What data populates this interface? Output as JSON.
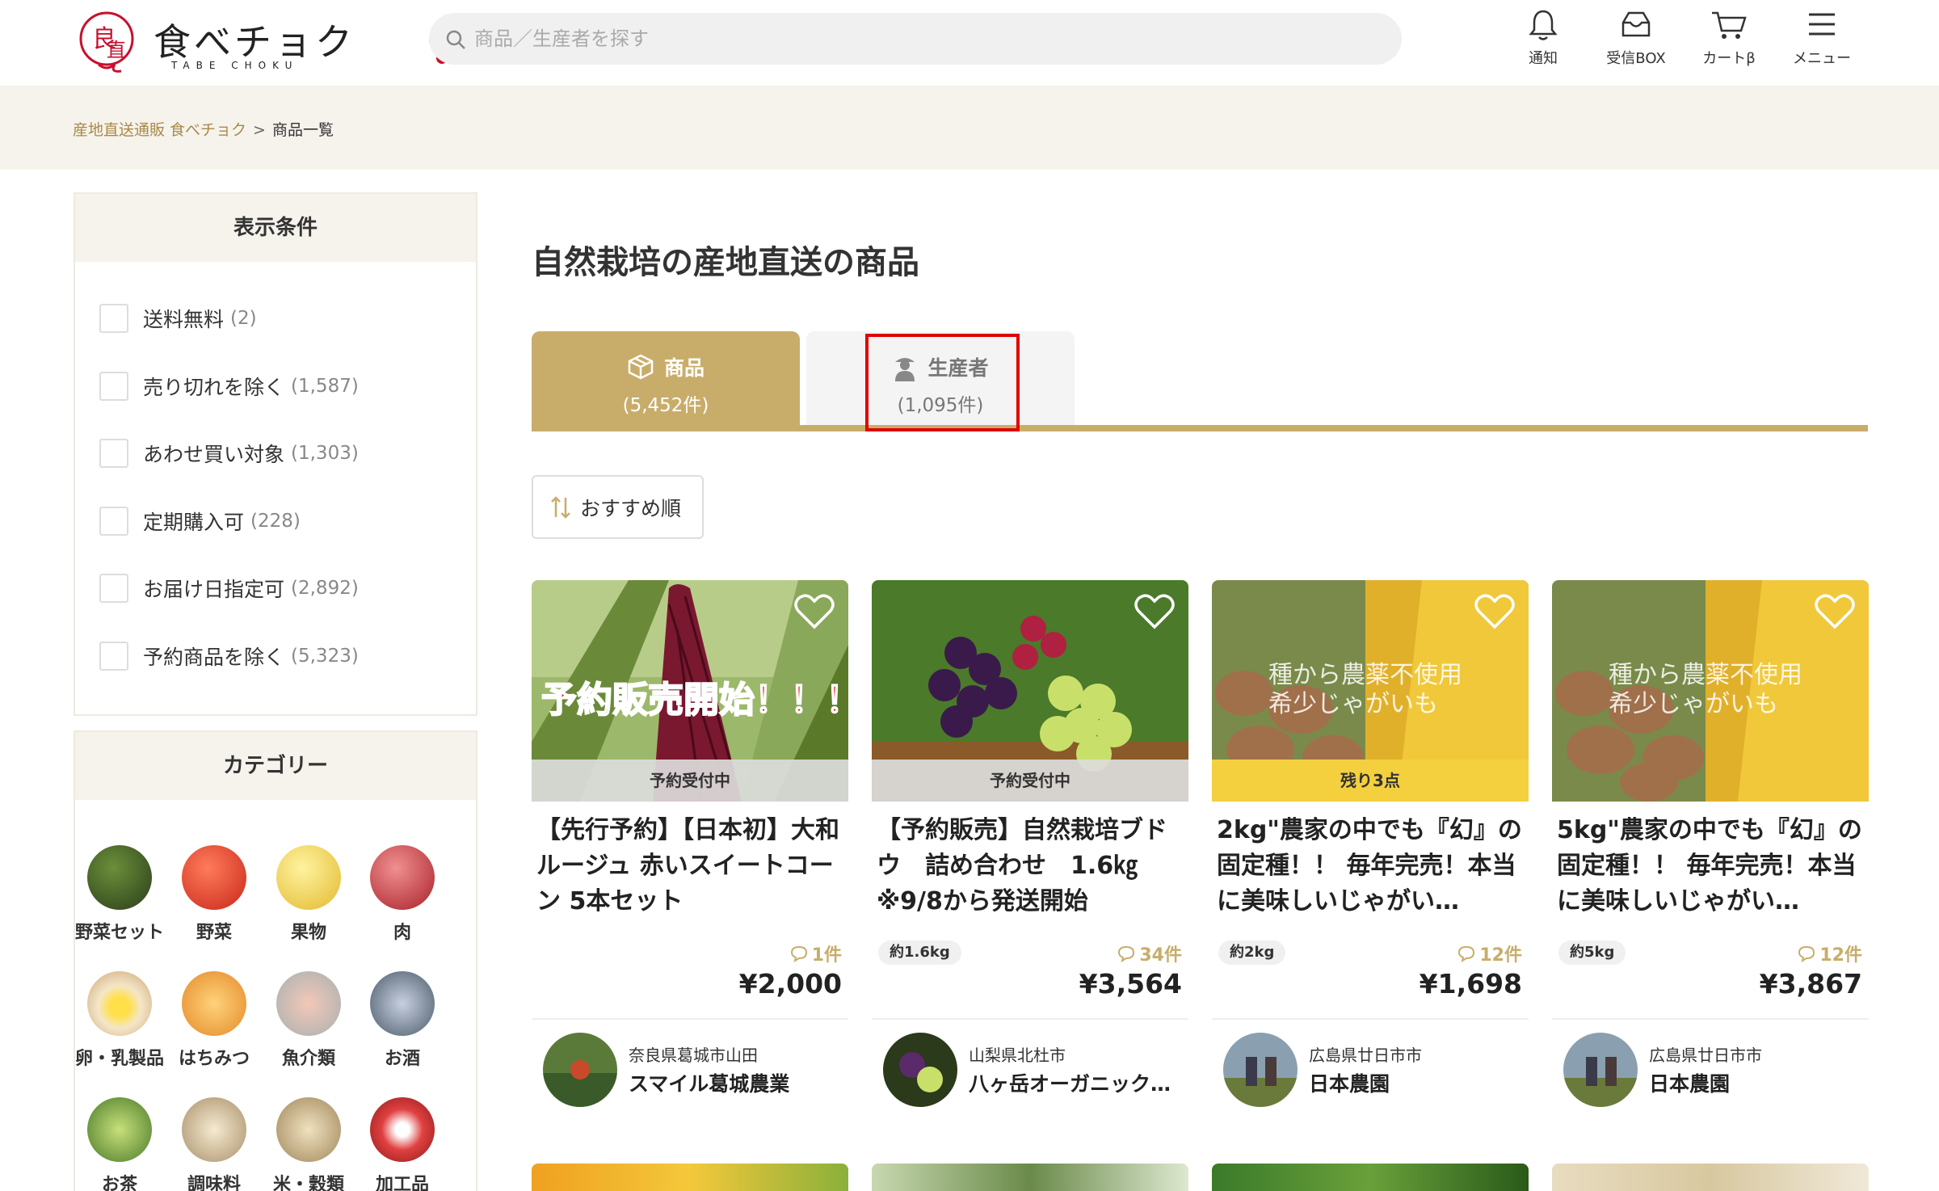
{
  "header": {
    "logo_text": "食べチョク",
    "logo_sub": "TABE CHOKU",
    "search_placeholder": "商品／生産者を探す",
    "nav": [
      {
        "label": "通知",
        "icon": "bell-icon"
      },
      {
        "label": "受信BOX",
        "icon": "inbox-icon"
      },
      {
        "label": "カートβ",
        "icon": "cart-icon"
      },
      {
        "label": "メニュー",
        "icon": "menu-icon"
      }
    ]
  },
  "breadcrumb": {
    "home": "産地直送通販 食べチョク",
    "separator": ">",
    "current": "商品一覧"
  },
  "filters": {
    "title": "表示条件",
    "items": [
      {
        "label": "送料無料",
        "count": "(2)"
      },
      {
        "label": "売り切れを除く",
        "count": "(1,587)"
      },
      {
        "label": "あわせ買い対象",
        "count": "(1,303)"
      },
      {
        "label": "定期購入可",
        "count": "(228)"
      },
      {
        "label": "お届け日指定可",
        "count": "(2,892)"
      },
      {
        "label": "予約商品を除く",
        "count": "(5,323)"
      }
    ]
  },
  "categories": {
    "title": "カテゴリー",
    "items": [
      {
        "label": "野菜セット",
        "color": "#3c5a2a"
      },
      {
        "label": "野菜",
        "color": "#e0452a"
      },
      {
        "label": "果物",
        "color": "#f2d24b"
      },
      {
        "label": "肉",
        "color": "#c2303a"
      },
      {
        "label": "卵・乳製品",
        "color": "#e9c88a"
      },
      {
        "label": "はちみつ",
        "color": "#e9a84a"
      },
      {
        "label": "魚介類",
        "color": "#d9a38e"
      },
      {
        "label": "お酒",
        "color": "#6a7c8a"
      },
      {
        "label": "お茶",
        "color": "#7aa84a"
      },
      {
        "label": "調味料",
        "color": "#d8c29a"
      },
      {
        "label": "米・穀類",
        "color": "#c9b48a"
      },
      {
        "label": "加工品",
        "color": "#c23a3a"
      }
    ]
  },
  "main": {
    "title": "自然栽培の産地直送の商品",
    "tabs": [
      {
        "label": "商品",
        "count": "(5,452件)"
      },
      {
        "label": "生産者",
        "count": "(1,095件)"
      }
    ],
    "sort_label": "おすすめ順"
  },
  "products": [
    {
      "title": "【先行予約】【日本初】大和ルージュ 赤いスイートコーン 5本セット",
      "status": "予約受付中",
      "overlay": "予約販売開始！！！",
      "weight": "",
      "reviews": "1件",
      "price": "¥2,000",
      "location": "奈良県葛城市山田",
      "producer": "スマイル葛城農業"
    },
    {
      "title": "【予約販売】自然栽培ブドウ　詰め合わせ　1.6㎏　※9/8から発送開始",
      "status": "予約受付中",
      "overlay": "",
      "weight": "約1.6kg",
      "reviews": "34件",
      "price": "¥3,564",
      "location": "山梨県北杜市",
      "producer": "八ヶ岳オーガニック…"
    },
    {
      "title": "2kg\"農家の中でも『幻』の固定種！！ 毎年完売！本当に美味しいじゃがい…",
      "status": "残り3点",
      "overlay": "種から農薬不使用\n希少じゃがいも",
      "weight": "約2kg",
      "reviews": "12件",
      "price": "¥1,698",
      "location": "広島県廿日市市",
      "producer": "日本農園"
    },
    {
      "title": "5kg\"農家の中でも『幻』の固定種！！ 毎年完売！本当に美味しいじゃがい…",
      "status": "",
      "overlay": "種から農薬不使用\n希少じゃがいも",
      "weight": "約5kg",
      "reviews": "12件",
      "price": "¥3,867",
      "location": "広島県廿日市市",
      "producer": "日本農園"
    }
  ]
}
